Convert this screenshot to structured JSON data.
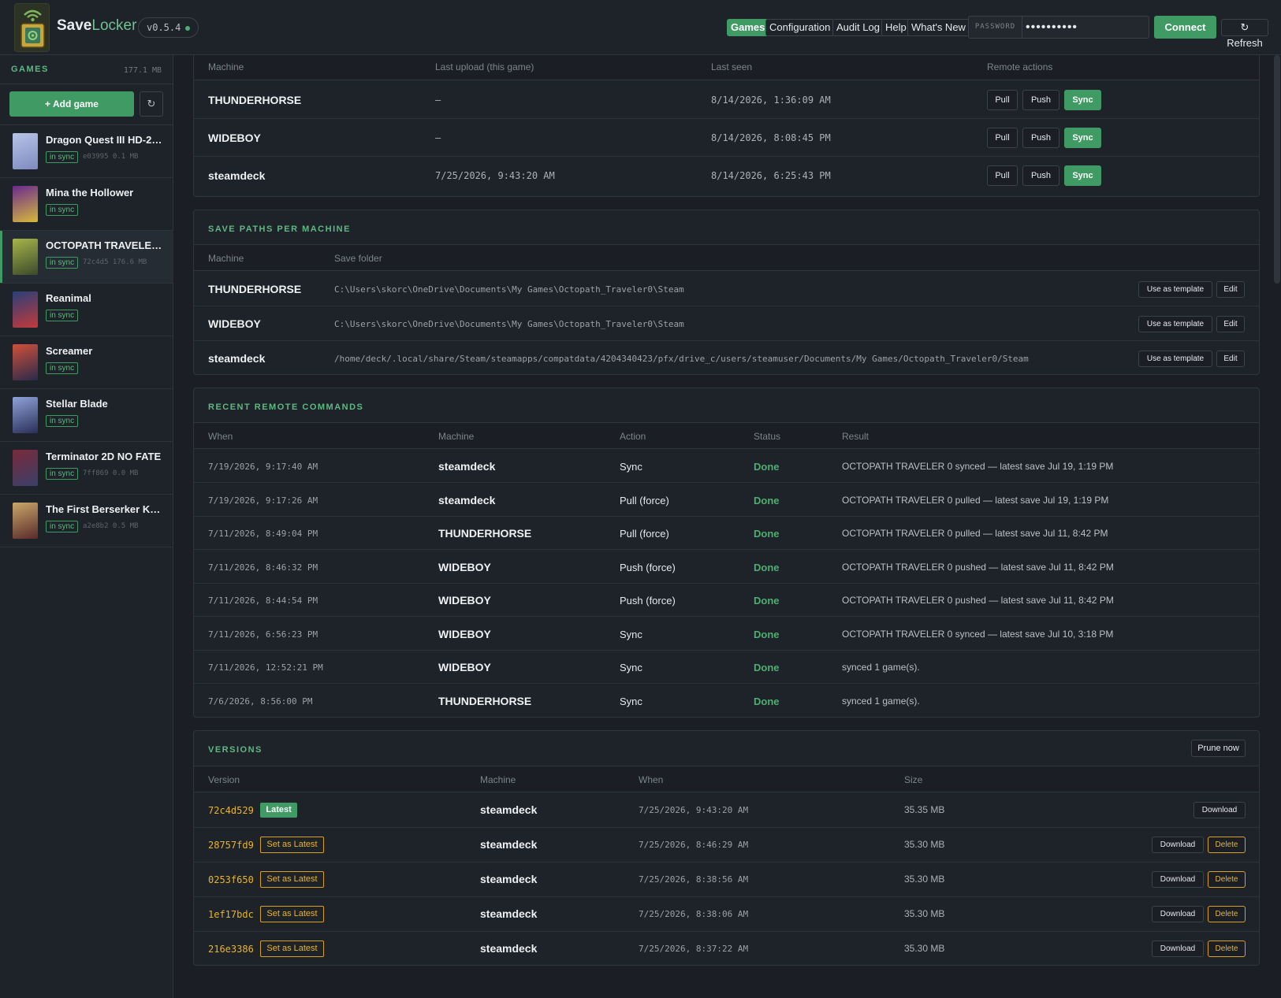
{
  "header": {
    "brand_part1": "Save",
    "brand_part2": "Locker",
    "version": "v0.5.4",
    "nav": [
      "Games",
      "Configuration",
      "Audit Log",
      "Help",
      "What's New"
    ],
    "password_label": "PASSWORD",
    "password_value": "••••••••••",
    "connect_label": "Connect",
    "refresh_label": "↻ Refresh"
  },
  "sidebar": {
    "heading": "GAMES",
    "total_size": "177.1 MB",
    "add_game_label": "+ Add game",
    "refresh_icon": "↻",
    "games": [
      {
        "name": "Dragon Quest III HD-2D...",
        "status": "in sync",
        "meta": "e03995 0.1 MB",
        "thumb": [
          "#b9c3e8",
          "#7d8bc0"
        ]
      },
      {
        "name": "Mina the Hollower",
        "status": "in sync",
        "meta": "",
        "thumb": [
          "#6a2a8f",
          "#d8b83a"
        ]
      },
      {
        "name": "OCTOPATH TRAVELER 0",
        "status": "in sync",
        "meta": "72c4d5 176.6 MB",
        "thumb": [
          "#a7b54a",
          "#3b4a2a"
        ]
      },
      {
        "name": "Reanimal",
        "status": "in sync",
        "meta": "",
        "thumb": [
          "#2a3f7a",
          "#c23a3a"
        ]
      },
      {
        "name": "Screamer",
        "status": "in sync",
        "meta": "",
        "thumb": [
          "#d0503a",
          "#2a2a4a"
        ]
      },
      {
        "name": "Stellar Blade",
        "status": "in sync",
        "meta": "",
        "thumb": [
          "#8fa2d8",
          "#2a2f5a"
        ]
      },
      {
        "name": "Terminator 2D NO FATE",
        "status": "in sync",
        "meta": "7ff869 0.0 MB",
        "thumb": [
          "#7a2a3a",
          "#3a3f6a"
        ]
      },
      {
        "name": "The First Berserker Kha...",
        "status": "in sync",
        "meta": "a2e8b2 0.5 MB",
        "thumb": [
          "#c8a86a",
          "#5a2a2a"
        ]
      }
    ]
  },
  "machines_table": {
    "columns": [
      "Machine",
      "Last upload (this game)",
      "Last seen",
      "Remote actions"
    ],
    "rows": [
      {
        "machine": "THUNDERHORSE",
        "last_upload": "–",
        "last_seen": "8/14/2026, 1:36:09 AM"
      },
      {
        "machine": "WIDEBOY",
        "last_upload": "–",
        "last_seen": "8/14/2026, 8:08:45 PM"
      },
      {
        "machine": "steamdeck",
        "last_upload": "7/25/2026, 9:43:20 AM",
        "last_seen": "8/14/2026, 6:25:43 PM"
      }
    ],
    "actions": [
      "Pull",
      "Push",
      "Sync"
    ]
  },
  "save_paths": {
    "title": "SAVE PATHS PER MACHINE",
    "columns": [
      "Machine",
      "Save folder"
    ],
    "rows": [
      {
        "machine": "THUNDERHORSE",
        "path": "C:\\Users\\skorc\\OneDrive\\Documents\\My Games\\Octopath_Traveler0\\Steam"
      },
      {
        "machine": "WIDEBOY",
        "path": "C:\\Users\\skorc\\OneDrive\\Documents\\My Games\\Octopath_Traveler0\\Steam"
      },
      {
        "machine": "steamdeck",
        "path": "/home/deck/.local/share/Steam/steamapps/compatdata/4204340423/pfx/drive_c/users/steamuser/Documents/My Games/Octopath_Traveler0/Steam"
      }
    ],
    "template_label": "Use as template",
    "edit_label": "Edit"
  },
  "commands": {
    "title": "RECENT REMOTE COMMANDS",
    "columns": [
      "When",
      "Machine",
      "Action",
      "Status",
      "Result"
    ],
    "rows": [
      {
        "when": "7/19/2026, 9:17:40 AM",
        "machine": "steamdeck",
        "action": "Sync",
        "status": "Done",
        "result": "OCTOPATH TRAVELER 0 synced — latest save Jul 19, 1:19 PM"
      },
      {
        "when": "7/19/2026, 9:17:26 AM",
        "machine": "steamdeck",
        "action": "Pull (force)",
        "status": "Done",
        "result": "OCTOPATH TRAVELER 0 pulled — latest save Jul 19, 1:19 PM"
      },
      {
        "when": "7/11/2026, 8:49:04 PM",
        "machine": "THUNDERHORSE",
        "action": "Pull (force)",
        "status": "Done",
        "result": "OCTOPATH TRAVELER 0 pulled — latest save Jul 11, 8:42 PM"
      },
      {
        "when": "7/11/2026, 8:46:32 PM",
        "machine": "WIDEBOY",
        "action": "Push (force)",
        "status": "Done",
        "result": "OCTOPATH TRAVELER 0 pushed — latest save Jul 11, 8:42 PM"
      },
      {
        "when": "7/11/2026, 8:44:54 PM",
        "machine": "WIDEBOY",
        "action": "Push (force)",
        "status": "Done",
        "result": "OCTOPATH TRAVELER 0 pushed — latest save Jul 11, 8:42 PM"
      },
      {
        "when": "7/11/2026, 6:56:23 PM",
        "machine": "WIDEBOY",
        "action": "Sync",
        "status": "Done",
        "result": "OCTOPATH TRAVELER 0 synced — latest save Jul 10, 3:18 PM"
      },
      {
        "when": "7/11/2026, 12:52:21 PM",
        "machine": "WIDEBOY",
        "action": "Sync",
        "status": "Done",
        "result": "synced 1 game(s)."
      },
      {
        "when": "7/6/2026, 8:56:00 PM",
        "machine": "THUNDERHORSE",
        "action": "Sync",
        "status": "Done",
        "result": "synced 1 game(s)."
      }
    ]
  },
  "versions": {
    "title": "VERSIONS",
    "prune_label": "Prune now",
    "columns": [
      "Version",
      "Machine",
      "When",
      "Size"
    ],
    "latest_label": "Latest",
    "set_latest_label": "Set as Latest",
    "download_label": "Download",
    "delete_label": "Delete",
    "rows": [
      {
        "hash": "72c4d529",
        "latest": true,
        "machine": "steamdeck",
        "when": "7/25/2026, 9:43:20 AM",
        "size": "35.35 MB"
      },
      {
        "hash": "28757fd9",
        "latest": false,
        "machine": "steamdeck",
        "when": "7/25/2026, 8:46:29 AM",
        "size": "35.30 MB"
      },
      {
        "hash": "0253f650",
        "latest": false,
        "machine": "steamdeck",
        "when": "7/25/2026, 8:38:56 AM",
        "size": "35.30 MB"
      },
      {
        "hash": "1ef17bdc",
        "latest": false,
        "machine": "steamdeck",
        "when": "7/25/2026, 8:38:06 AM",
        "size": "35.30 MB"
      },
      {
        "hash": "216e3386",
        "latest": false,
        "machine": "steamdeck",
        "when": "7/25/2026, 8:37:22 AM",
        "size": "35.30 MB"
      }
    ]
  },
  "colors": {
    "accent": "#3f9a63",
    "amber": "#e8b42a",
    "bg": "#1b1f25"
  }
}
